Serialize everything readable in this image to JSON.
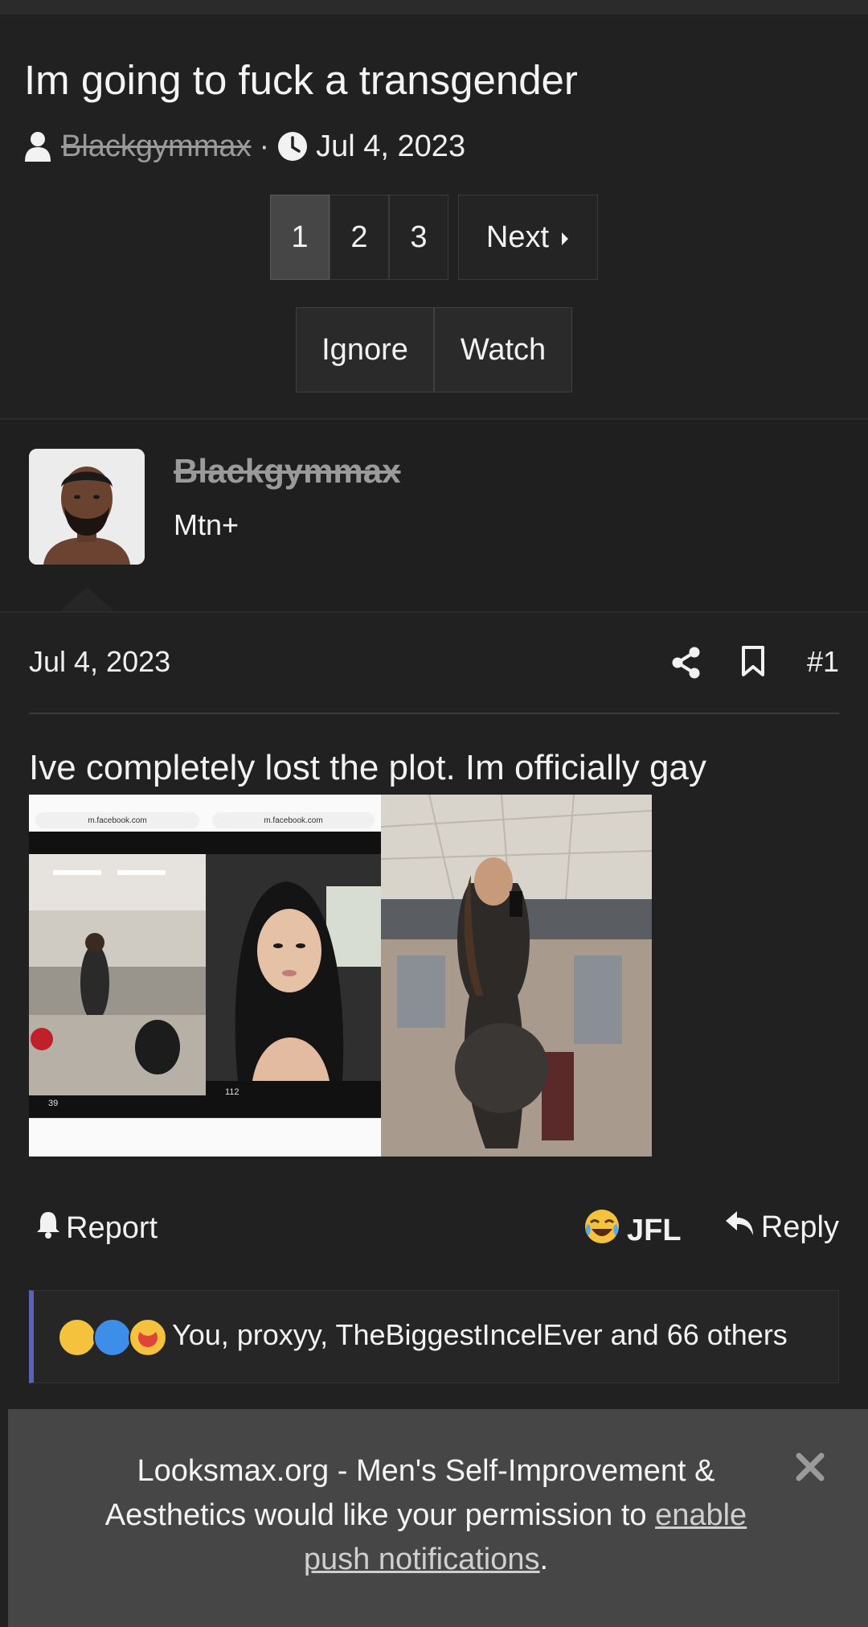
{
  "thread": {
    "title": "Im going to fuck a transgender",
    "author": "Blackgymmax",
    "separator": "·",
    "date": "Jul 4, 2023"
  },
  "pagination": {
    "pages": [
      "1",
      "2",
      "3"
    ],
    "current_page": 1,
    "next_label": "Next"
  },
  "thread_actions": {
    "ignore_label": "Ignore",
    "watch_label": "Watch"
  },
  "post": {
    "user": {
      "name": "Blackgymmax",
      "title": "Mtn+"
    },
    "date": "Jul 4, 2023",
    "number": "#1",
    "body": "Ive completely lost the plot. Im officially gay",
    "attachments": [
      {
        "url": "m.facebook.com",
        "likes": "39"
      },
      {
        "url": "m.facebook.com",
        "likes": "112"
      },
      {}
    ],
    "actions": {
      "report_label": "Report",
      "reaction_label": "JFL",
      "reply_label": "Reply"
    },
    "reactions": {
      "text": "You, proxyy, TheBiggestIncelEver and 66 others",
      "emojis": [
        "crying-laughing-emoji",
        "thumbs-up-emoji",
        "heart-eyes-emoji"
      ]
    }
  },
  "notification_banner": {
    "text_before": "Looksmax.org - Men's Self-Improvement & Aesthetics would like your permission to ",
    "link_text": "enable push notifications",
    "text_after": "."
  },
  "colors": {
    "background": "#212121",
    "reaction_accent": "#5a63b8",
    "banner_background": "#464646"
  }
}
